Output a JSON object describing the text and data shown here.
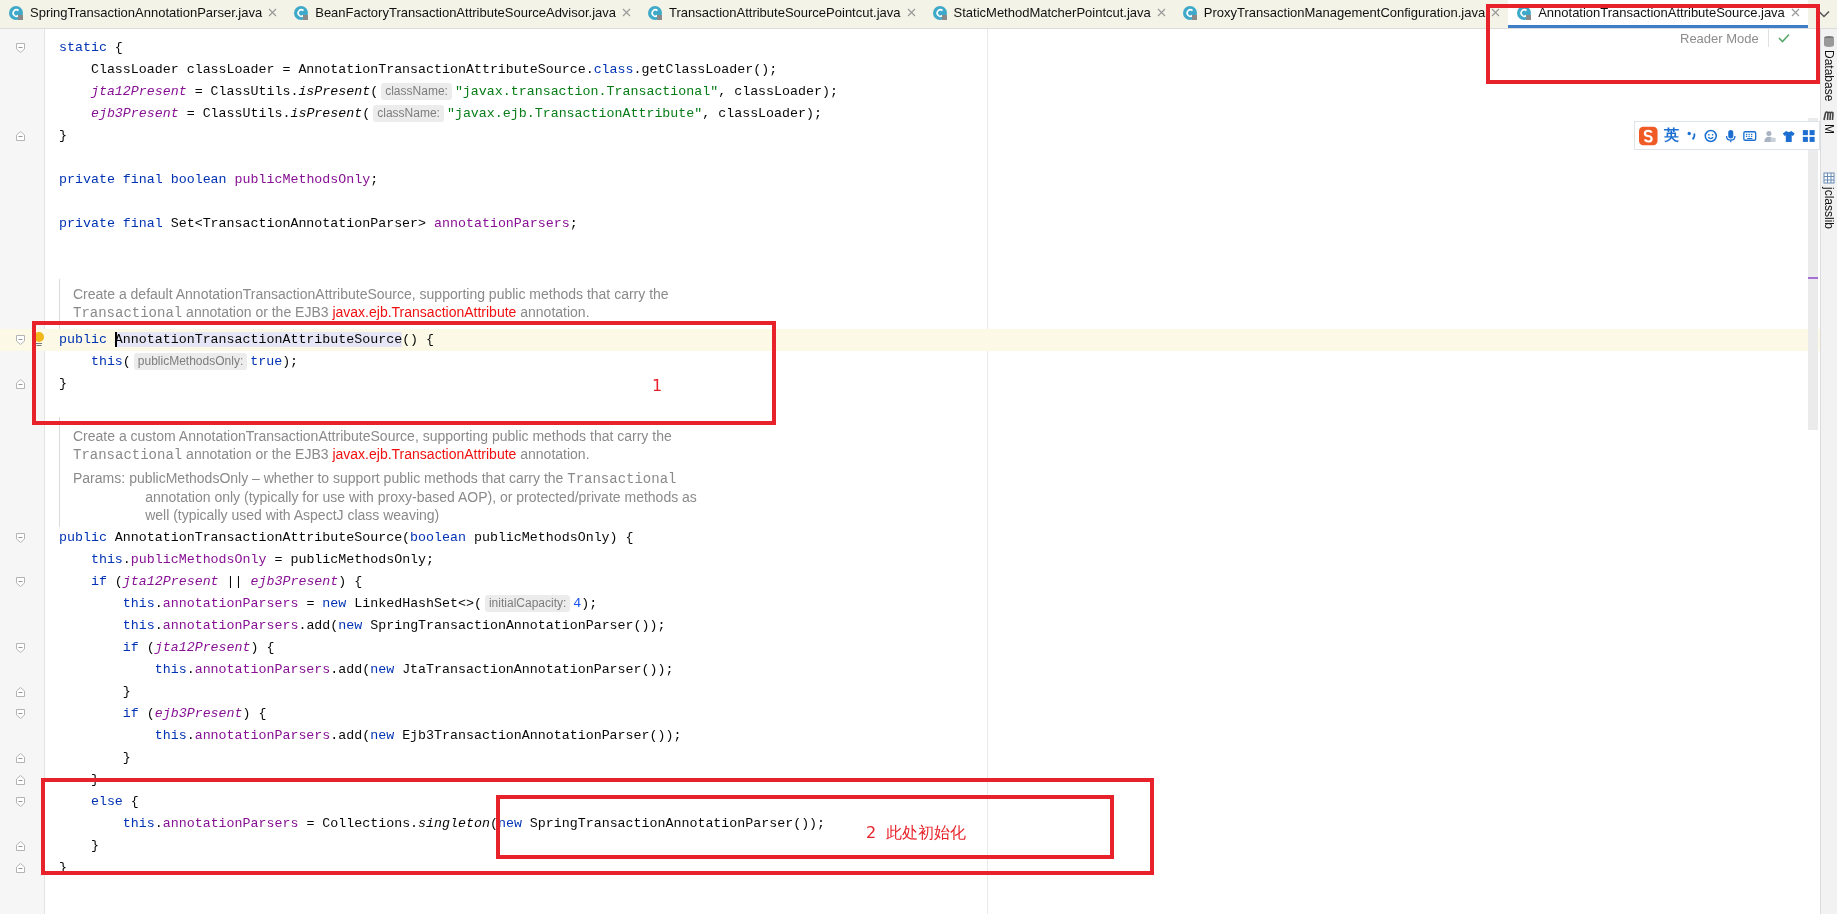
{
  "tabs": [
    {
      "label": "SpringTransactionAnnotationParser.java",
      "selected": false
    },
    {
      "label": "BeanFactoryTransactionAttributeSourceAdvisor.java",
      "selected": false
    },
    {
      "label": "TransactionAttributeSourcePointcut.java",
      "selected": false
    },
    {
      "label": "StaticMethodMatcherPointcut.java",
      "selected": false
    },
    {
      "label": "ProxyTransactionManagementConfiguration.java",
      "selected": false
    },
    {
      "label": "AnnotationTransactionAttributeSource.java",
      "selected": true
    }
  ],
  "reader_mode": {
    "label": "Reader Mode"
  },
  "code": [
    {
      "kind": "code",
      "current": false,
      "fold": {
        "kind": "start"
      },
      "tokens": [
        {
          "kind": "keyword",
          "text": "static"
        },
        {
          "kind": "plain",
          "text": " {"
        }
      ]
    },
    {
      "kind": "code",
      "current": false,
      "tokens": [
        {
          "kind": "plain",
          "text": "    ClassLoader classLoader = AnnotationTransactionAttributeSource."
        },
        {
          "kind": "keyword",
          "text": "class"
        },
        {
          "kind": "plain",
          "text": ".getClassLoader();"
        }
      ]
    },
    {
      "kind": "code",
      "current": false,
      "tokens": [
        {
          "kind": "static_field",
          "text": "    jta12Present"
        },
        {
          "kind": "plain",
          "text": " = ClassUtils."
        },
        {
          "kind": "static_method",
          "text": "isPresent"
        },
        {
          "kind": "plain",
          "text": "("
        },
        {
          "kind": "hint",
          "text": "className:"
        },
        {
          "kind": "string",
          "text": "\"javax.transaction.Transactional\""
        },
        {
          "kind": "plain",
          "text": ", classLoader);"
        }
      ]
    },
    {
      "kind": "code",
      "current": false,
      "tokens": [
        {
          "kind": "static_field",
          "text": "    ejb3Present"
        },
        {
          "kind": "plain",
          "text": " = ClassUtils."
        },
        {
          "kind": "static_method",
          "text": "isPresent"
        },
        {
          "kind": "plain",
          "text": "("
        },
        {
          "kind": "hint",
          "text": "className:"
        },
        {
          "kind": "string",
          "text": "\"javax.ejb.TransactionAttribute\""
        },
        {
          "kind": "plain",
          "text": ", classLoader);"
        }
      ]
    },
    {
      "kind": "code",
      "current": false,
      "fold": {
        "kind": "end"
      },
      "tokens": [
        {
          "kind": "plain",
          "text": "}"
        }
      ]
    },
    {
      "kind": "blank"
    },
    {
      "kind": "code",
      "current": false,
      "tokens": [
        {
          "kind": "keyword",
          "text": "private final boolean "
        },
        {
          "kind": "field",
          "text": "publicMethodsOnly"
        },
        {
          "kind": "plain",
          "text": ";"
        }
      ]
    },
    {
      "kind": "blank"
    },
    {
      "kind": "code",
      "current": false,
      "tokens": [
        {
          "kind": "keyword",
          "text": "private final "
        },
        {
          "kind": "plain",
          "text": "Set<TransactionAnnotationParser> "
        },
        {
          "kind": "field",
          "text": "annotationParsers"
        },
        {
          "kind": "plain",
          "text": ";"
        }
      ]
    },
    {
      "kind": "blank"
    },
    {
      "kind": "blank"
    },
    {
      "kind": "doc",
      "lines": [
        [
          {
            "kind": "text",
            "text": "Create a default AnnotationTransactionAttributeSource, supporting public methods that carry the"
          }
        ],
        [
          {
            "kind": "code",
            "text": "Transactional"
          },
          {
            "kind": "text",
            "text": " annotation or the EJB3 "
          },
          {
            "kind": "link",
            "text": "javax.ejb.TransactionAttribute"
          },
          {
            "kind": "text",
            "text": " annotation."
          }
        ]
      ]
    },
    {
      "kind": "code",
      "current": true,
      "bulb": true,
      "fold": {
        "kind": "start"
      },
      "tokens": [
        {
          "kind": "keyword",
          "text": "public "
        },
        {
          "kind": "plain",
          "text": "AnnotationTransactionAttributeSource",
          "highlighted": true,
          "caret": true
        },
        {
          "kind": "plain",
          "text": "() {"
        }
      ]
    },
    {
      "kind": "code",
      "current": false,
      "tokens": [
        {
          "kind": "keyword",
          "text": "    this"
        },
        {
          "kind": "plain",
          "text": "("
        },
        {
          "kind": "hint",
          "text": "publicMethodsOnly:"
        },
        {
          "kind": "keyword",
          "text": "true"
        },
        {
          "kind": "plain",
          "text": ");"
        }
      ]
    },
    {
      "kind": "code",
      "current": false,
      "fold": {
        "kind": "end"
      },
      "tokens": [
        {
          "kind": "plain",
          "text": "}"
        }
      ]
    },
    {
      "kind": "blank"
    },
    {
      "kind": "doc",
      "lines": [
        [
          {
            "kind": "text",
            "text": "Create a custom AnnotationTransactionAttributeSource, supporting public methods that carry the"
          }
        ],
        [
          {
            "kind": "code",
            "text": "Transactional"
          },
          {
            "kind": "text",
            "text": " annotation or the EJB3 "
          },
          {
            "kind": "link",
            "text": "javax.ejb.TransactionAttribute"
          },
          {
            "kind": "text",
            "text": " annotation."
          }
        ]
      ],
      "params": {
        "label": "Params:",
        "lines": [
          [
            {
              "kind": "text",
              "text": "publicMethodsOnly – whether to support public methods that carry the "
            },
            {
              "kind": "code",
              "text": "Transactional"
            }
          ],
          [
            {
              "kind": "text",
              "text": "annotation only (typically for use with proxy-based AOP), or protected/private methods as"
            }
          ],
          [
            {
              "kind": "text",
              "text": "well (typically used with AspectJ class weaving)"
            }
          ]
        ]
      }
    },
    {
      "kind": "code",
      "current": false,
      "fold": {
        "kind": "start"
      },
      "tokens": [
        {
          "kind": "keyword",
          "text": "public "
        },
        {
          "kind": "plain",
          "text": "AnnotationTransactionAttributeSource("
        },
        {
          "kind": "keyword",
          "text": "boolean "
        },
        {
          "kind": "plain",
          "text": "publicMethodsOnly) {"
        }
      ]
    },
    {
      "kind": "code",
      "current": false,
      "tokens": [
        {
          "kind": "keyword",
          "text": "    this"
        },
        {
          "kind": "plain",
          "text": "."
        },
        {
          "kind": "field",
          "text": "publicMethodsOnly"
        },
        {
          "kind": "plain",
          "text": " = publicMethodsOnly;"
        }
      ]
    },
    {
      "kind": "code",
      "current": false,
      "fold": {
        "kind": "start"
      },
      "tokens": [
        {
          "kind": "keyword",
          "text": "    if "
        },
        {
          "kind": "plain",
          "text": "("
        },
        {
          "kind": "static_field",
          "text": "jta12Present"
        },
        {
          "kind": "plain",
          "text": " || "
        },
        {
          "kind": "static_field",
          "text": "ejb3Present"
        },
        {
          "kind": "plain",
          "text": ") {"
        }
      ]
    },
    {
      "kind": "code",
      "current": false,
      "tokens": [
        {
          "kind": "keyword",
          "text": "        this"
        },
        {
          "kind": "plain",
          "text": "."
        },
        {
          "kind": "field",
          "text": "annotationParsers"
        },
        {
          "kind": "plain",
          "text": " = "
        },
        {
          "kind": "keyword",
          "text": "new "
        },
        {
          "kind": "plain",
          "text": "LinkedHashSet<>("
        },
        {
          "kind": "hint",
          "text": "initialCapacity:"
        },
        {
          "kind": "number",
          "text": "4"
        },
        {
          "kind": "plain",
          "text": ");"
        }
      ]
    },
    {
      "kind": "code",
      "current": false,
      "tokens": [
        {
          "kind": "keyword",
          "text": "        this"
        },
        {
          "kind": "plain",
          "text": "."
        },
        {
          "kind": "field",
          "text": "annotationParsers"
        },
        {
          "kind": "plain",
          "text": ".add("
        },
        {
          "kind": "keyword",
          "text": "new "
        },
        {
          "kind": "plain",
          "text": "SpringTransactionAnnotationParser());"
        }
      ]
    },
    {
      "kind": "code",
      "current": false,
      "fold": {
        "kind": "start"
      },
      "tokens": [
        {
          "kind": "keyword",
          "text": "        if "
        },
        {
          "kind": "plain",
          "text": "("
        },
        {
          "kind": "static_field",
          "text": "jta12Present"
        },
        {
          "kind": "plain",
          "text": ") {"
        }
      ]
    },
    {
      "kind": "code",
      "current": false,
      "tokens": [
        {
          "kind": "keyword",
          "text": "            this"
        },
        {
          "kind": "plain",
          "text": "."
        },
        {
          "kind": "field",
          "text": "annotationParsers"
        },
        {
          "kind": "plain",
          "text": ".add("
        },
        {
          "kind": "keyword",
          "text": "new "
        },
        {
          "kind": "plain",
          "text": "JtaTransactionAnnotationParser());"
        }
      ]
    },
    {
      "kind": "code",
      "current": false,
      "fold": {
        "kind": "end"
      },
      "tokens": [
        {
          "kind": "plain",
          "text": "        }"
        }
      ]
    },
    {
      "kind": "code",
      "current": false,
      "fold": {
        "kind": "start"
      },
      "tokens": [
        {
          "kind": "keyword",
          "text": "        if "
        },
        {
          "kind": "plain",
          "text": "("
        },
        {
          "kind": "static_field",
          "text": "ejb3Present"
        },
        {
          "kind": "plain",
          "text": ") {"
        }
      ]
    },
    {
      "kind": "code",
      "current": false,
      "tokens": [
        {
          "kind": "keyword",
          "text": "            this"
        },
        {
          "kind": "plain",
          "text": "."
        },
        {
          "kind": "field",
          "text": "annotationParsers"
        },
        {
          "kind": "plain",
          "text": ".add("
        },
        {
          "kind": "keyword",
          "text": "new "
        },
        {
          "kind": "plain",
          "text": "Ejb3TransactionAnnotationParser());"
        }
      ]
    },
    {
      "kind": "code",
      "current": false,
      "fold": {
        "kind": "end"
      },
      "tokens": [
        {
          "kind": "plain",
          "text": "        }"
        }
      ]
    },
    {
      "kind": "code",
      "current": false,
      "fold": {
        "kind": "end"
      },
      "tokens": [
        {
          "kind": "plain",
          "text": "    }"
        }
      ]
    },
    {
      "kind": "code",
      "current": false,
      "fold": {
        "kind": "start"
      },
      "tokens": [
        {
          "kind": "keyword",
          "text": "    else"
        },
        {
          "kind": "plain",
          "text": " {"
        }
      ]
    },
    {
      "kind": "code",
      "current": false,
      "tokens": [
        {
          "kind": "keyword",
          "text": "        this"
        },
        {
          "kind": "plain",
          "text": "."
        },
        {
          "kind": "field",
          "text": "annotationParsers"
        },
        {
          "kind": "plain",
          "text": " = Collections."
        },
        {
          "kind": "static_method",
          "text": "singleton"
        },
        {
          "kind": "plain",
          "text": "("
        },
        {
          "kind": "keyword",
          "text": "new "
        },
        {
          "kind": "plain",
          "text": "SpringTransactionAnnotationParser());"
        }
      ]
    },
    {
      "kind": "code",
      "current": false,
      "fold": {
        "kind": "end"
      },
      "tokens": [
        {
          "kind": "plain",
          "text": "    }"
        }
      ]
    },
    {
      "kind": "code",
      "current": false,
      "fold": {
        "kind": "end"
      },
      "tokens": [
        {
          "kind": "plain",
          "text": "}"
        }
      ]
    },
    {
      "kind": "blank"
    }
  ],
  "tool_windows": [
    {
      "label": "Database"
    },
    {
      "label": "M"
    },
    {
      "label": "jclasslib"
    }
  ],
  "ime_toolbar": {
    "language": "英"
  },
  "annotations": [
    {
      "kind": "box"
    },
    {
      "kind": "box",
      "label": "1"
    },
    {
      "kind": "box"
    },
    {
      "kind": "box",
      "label": "2  此处初始化"
    }
  ]
}
